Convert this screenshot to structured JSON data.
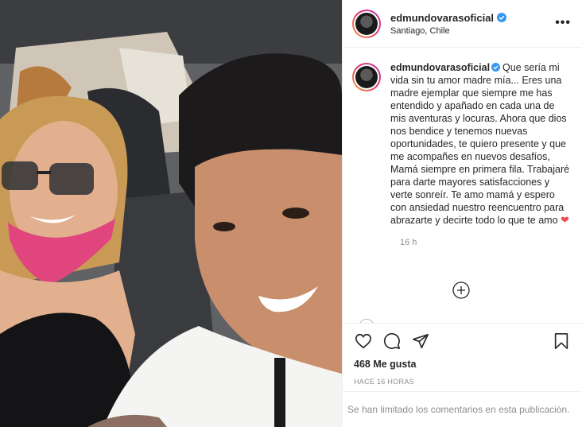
{
  "post": {
    "username": "edmundovarasoficial",
    "location": "Santiago, Chile",
    "more_label": "•••"
  },
  "caption": {
    "username": "edmundovarasoficial",
    "text": "Que sería mi vida sin tu amor madre mía... Eres una madre ejemplar que siempre me has entendido y apañado en cada una de mis aventuras y locuras.  Ahora que dios nos bendice y tenemos nuevas oportunidades, te quiero presente y que me acompañes en nuevos desafíos, Mamá siempre en primera fila.  Trabajaré para darte mayores satisfacciones y verte sonreír. Te amo mamá y espero con ansiedad nuestro reencuentro para abrazarte y decirte todo lo que te amo",
    "emoji": "❤",
    "time": "16 h"
  },
  "engagement": {
    "likes": "468 Me gusta",
    "ago": "HACE 16 HORAS"
  },
  "footer": {
    "notice": "Se han limitado los comentarios en esta publicación."
  },
  "icons": {
    "like": "heart-outline-icon",
    "comment": "comment-bubble-icon",
    "share": "paper-plane-icon",
    "save": "bookmark-icon",
    "load_more": "plus-circle-icon",
    "verified": "verified-badge-icon"
  },
  "colors": {
    "verified": "#3897f0",
    "heart": "#ed4956",
    "muted": "#8e8e8e",
    "text": "#262626"
  }
}
